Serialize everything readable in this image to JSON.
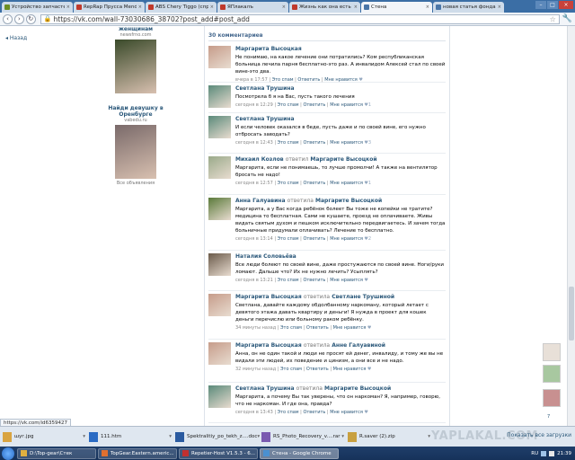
{
  "browser": {
    "tabs": [
      {
        "title": "Устройство запчастей",
        "color": "#6b8e23"
      },
      {
        "title": "RepRap Прусса Mendel",
        "color": "#c0392b"
      },
      {
        "title": "ABS Chery Tiggo (спр",
        "color": "#c0392b"
      },
      {
        "title": "ЯПлакалъ",
        "color": "#c0392b"
      },
      {
        "title": "Жизнь как она есть",
        "color": "#c0392b"
      },
      {
        "title": "Стена",
        "color": "#4a76a8"
      },
      {
        "title": "новая статья фонда",
        "color": "#4a76a8"
      }
    ],
    "active_tab_index": 5,
    "url": "https://vk.com/wall-73030686_38702?post_add#post_add"
  },
  "left": {
    "back_label": "Назад",
    "ads": [
      {
        "title": "женщинам",
        "domain": "newsfrno.com",
        "img_bg": "#3a4a2a"
      },
      {
        "title": "Найди девушку в Оренбурге",
        "domain": "vabedu.ru",
        "img_bg": "#7a6a6a"
      }
    ],
    "all_ads_label": "Все объявления"
  },
  "feed": {
    "comments_count": "30 комментариев",
    "reply_label": "Это спам",
    "answer_label": "Ответить",
    "like_label": "Мне нравится",
    "comments": [
      {
        "author": "Маргарита Высоцкая",
        "verb": "",
        "target": "",
        "text": "Не понимаю, на какое лечение они потратились? Ком республиканская больница лечила парня бесплатно-это раз. А инвалидом Алексей стал по своей вине-это два.",
        "time": "вчера в 17:57",
        "likes": "",
        "avatar": "#c69c8a"
      },
      {
        "author": "Светлана Трушина",
        "verb": "",
        "target": "",
        "text": "Посмотрела б я на Вас, пусть такого лечения",
        "time": "сегодня в 12:29",
        "likes": "1",
        "avatar": "#5a8a7a"
      },
      {
        "author": "Светлана Трушина",
        "verb": "",
        "target": "",
        "text": "И если человек оказался в беде, пусть даже и по своей вине, его нужно отбросать заводать?",
        "time": "сегодня в 12:43",
        "likes": "3",
        "avatar": "#5a8a7a"
      },
      {
        "author": "Михаил Козлов",
        "verb": "ответил",
        "target": "Маргарите Высоцкой",
        "text": "Маргарита, если не понимаешь, то лучше промолчи! А также на вентилятор бросать не надо!",
        "time": "сегодня в 12:57",
        "likes": "1",
        "avatar": "#9aaa8a"
      },
      {
        "author": "Анна Галуавина",
        "verb": "ответила",
        "target": "Маргарите Высоцкой",
        "text": "Маргарита, а у Вас когда ребёнок болеет Вы тоже не копейки не тратите? медицина то бесплатная. Сами не кушаете, проезд не оплачиваете. Живы видать святым духом и пешком исключительно передвигаетесь. И зачем тогда больничные придумали оплачивать? Лечение то бесплатно.",
        "time": "сегодня в 13:14",
        "likes": "2",
        "avatar": "#5a7a3a"
      },
      {
        "author": "Наталия Соловьёва",
        "verb": "",
        "target": "",
        "text": "Все люди болеют по своей вине, даже простужаются по своей вине. Ноги/руки ломают. Дальше что? Их не нужно лечить? Усыплять?",
        "time": "сегодня в 13:21",
        "likes": "",
        "avatar": "#6a5a4a"
      },
      {
        "author": "Маргарита Высоцкая",
        "verb": "ответила",
        "target": "Светлане Трушиной",
        "text": "Светлана, давайте каждому обдолбанному наркоману, который летает с девятого этажа давать квартиру и деньги! Я нужда в проект для кошек деньги перечислю или больному раком ребёнку.",
        "time": "34 минуты назад",
        "likes": "",
        "avatar": "#c69c8a"
      },
      {
        "author": "Маргарита Высоцкая",
        "verb": "ответила",
        "target": "Анне Галуавиной",
        "text": "Анна, он не один такой и люди не просят ей денег, инвалиду, и тому же вы не видали эти людей, их поведение и цинизм, а они все и не надо.",
        "time": "32 минуты назад",
        "likes": "",
        "avatar": "#c69c8a"
      },
      {
        "author": "Светлана Трушина",
        "verb": "ответила",
        "target": "Маргарите Высоцкой",
        "text": "Маргарита, а почему Вы так уверены, что он наркоман? Я, например, говорю, что не наркоман. И где она, правда?",
        "time": "сегодня в 13:43",
        "likes": "",
        "avatar": "#5a8a7a"
      }
    ]
  },
  "right_widgets": {
    "count": "7"
  },
  "status_url": "https://vk.com/id6359427",
  "downloads": {
    "items": [
      {
        "name": "шуг.jpg",
        "color": "#d9a441"
      },
      {
        "name": "111.htm",
        "color": "#2a6bc4"
      },
      {
        "name": "Spektralitiy_po_tekh_z....doc",
        "color": "#2a5aa0"
      },
      {
        "name": "RS_Photo_Recovery_v....rar",
        "color": "#7a5ab0"
      },
      {
        "name": "R.saver (2).zip",
        "color": "#c8a040"
      }
    ],
    "show_all_label": "Показать все загрузки",
    "watermark": "YAPLAKAL.COM"
  },
  "taskbar": {
    "items": [
      {
        "label": "D:\\Top-gear\\Стек",
        "color": "#e0b040"
      },
      {
        "label": "TopGear.Eastern.americ...",
        "color": "#e07030"
      },
      {
        "label": "Repetier-Host V1.5.3 - 6...",
        "color": "#c03030"
      },
      {
        "label": "Стена - Google Chrome",
        "color": "#4a90d0"
      }
    ],
    "active_index": 3,
    "lang": "RU",
    "clock": "21:39"
  }
}
